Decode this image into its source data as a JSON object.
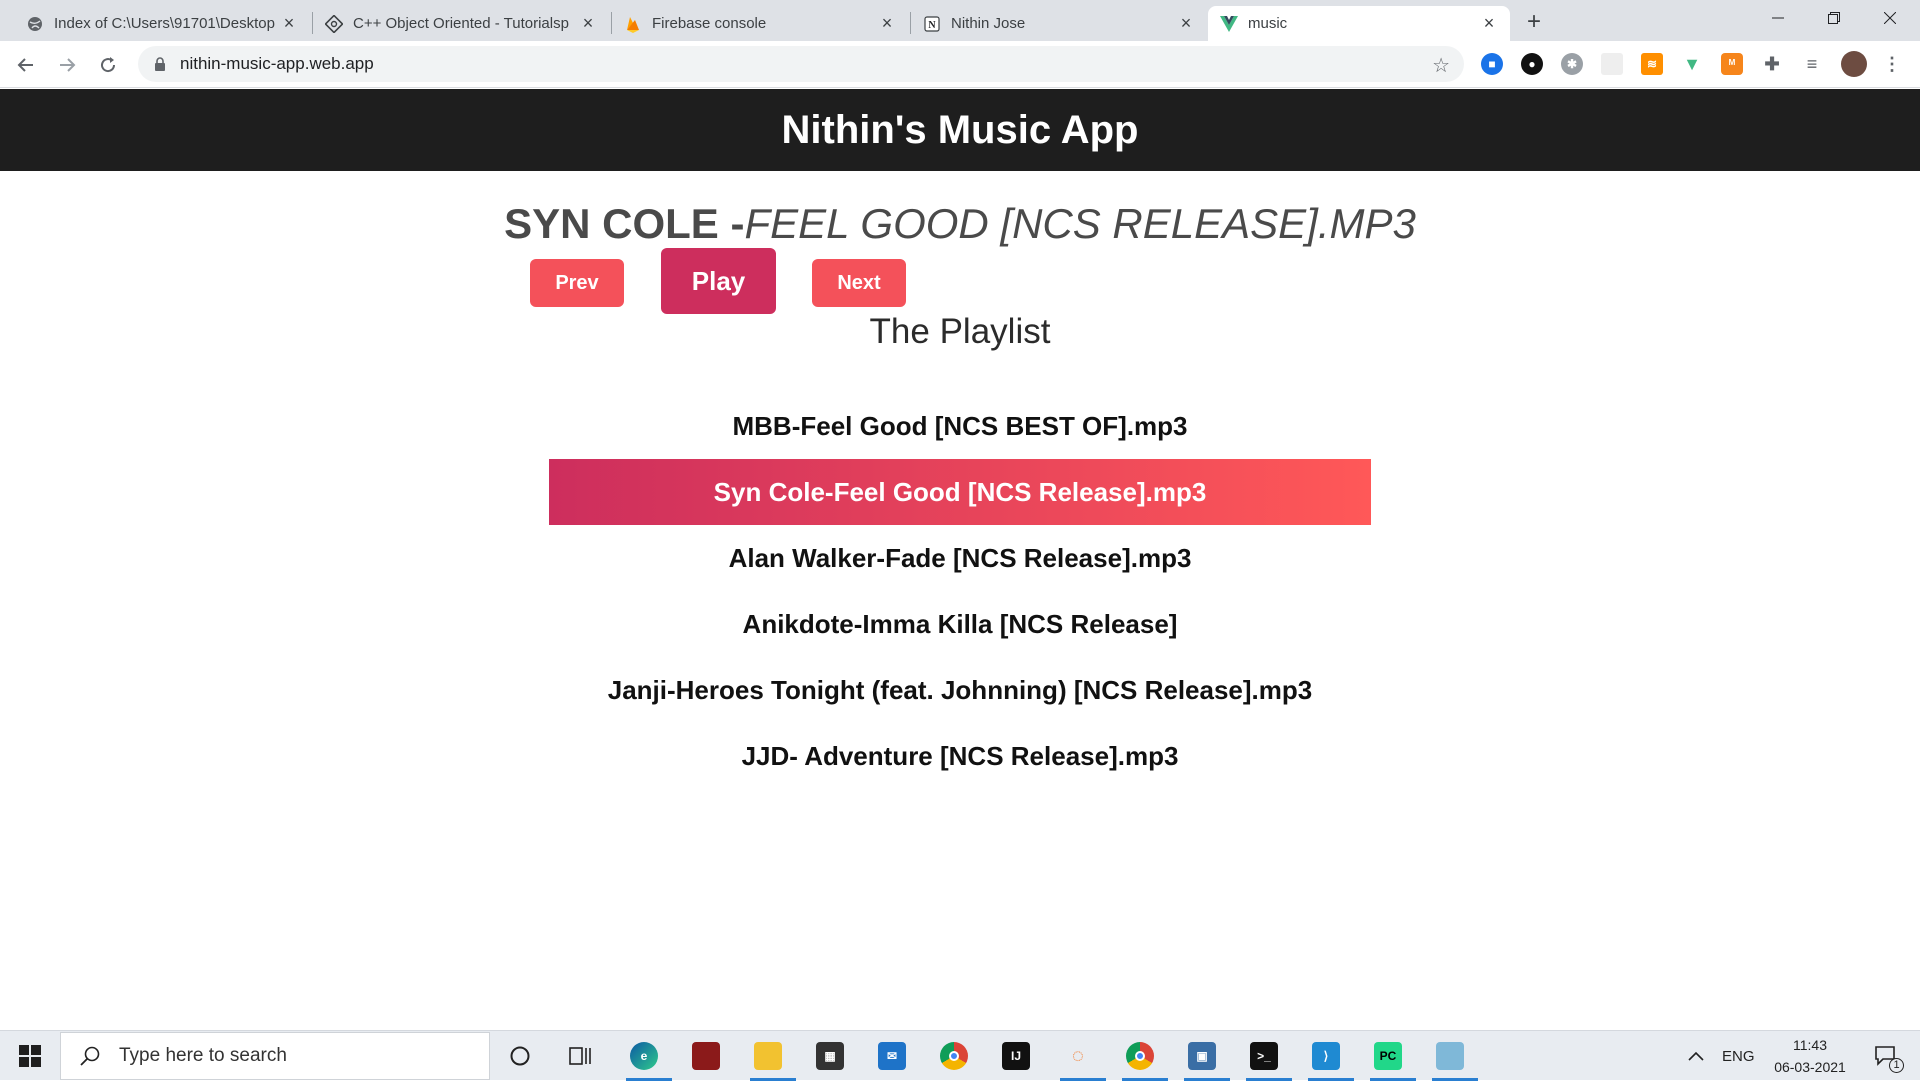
{
  "browser": {
    "tabs": [
      {
        "title": "Index of C:\\Users\\91701\\Desktop",
        "icon": "globe-icon"
      },
      {
        "title": "C++ Object Oriented - Tutorialsp",
        "icon": "tutorialspoint-icon"
      },
      {
        "title": "Firebase console",
        "icon": "firebase-icon"
      },
      {
        "title": "Nithin Jose",
        "icon": "notion-icon"
      },
      {
        "title": "music",
        "icon": "vue-icon",
        "active": true
      }
    ],
    "url": "nithin-music-app.web.app"
  },
  "app": {
    "title": "Nithin's Music App",
    "now_playing": {
      "artist": "Syn Cole -",
      "track": "Feel Good [NCS Release].mp3"
    },
    "buttons": {
      "prev": "Prev",
      "play": "Play",
      "next": "Next"
    },
    "playlist_title": "The Playlist",
    "playlist": [
      "MBB-Feel Good [NCS BEST OF].mp3",
      "Syn Cole-Feel Good [NCS Release].mp3",
      "Alan Walker-Fade [NCS Release].mp3",
      "Anikdote-Imma Killa [NCS Release]",
      "Janji-Heroes Tonight (feat. Johnning) [NCS Release].mp3",
      "JJD- Adventure [NCS Release].mp3"
    ],
    "active_index": 1,
    "colors": {
      "header_bg": "#1e1e1e",
      "button": "#f4515a",
      "play_button": "#cd2e5d",
      "active_gradient_start": "#cd2e5d",
      "active_gradient_end": "#ff5858"
    }
  },
  "taskbar": {
    "search_placeholder": "Type here to search",
    "language": "ENG",
    "time": "11:43",
    "date": "06-03-2021",
    "notification_count": "1"
  }
}
